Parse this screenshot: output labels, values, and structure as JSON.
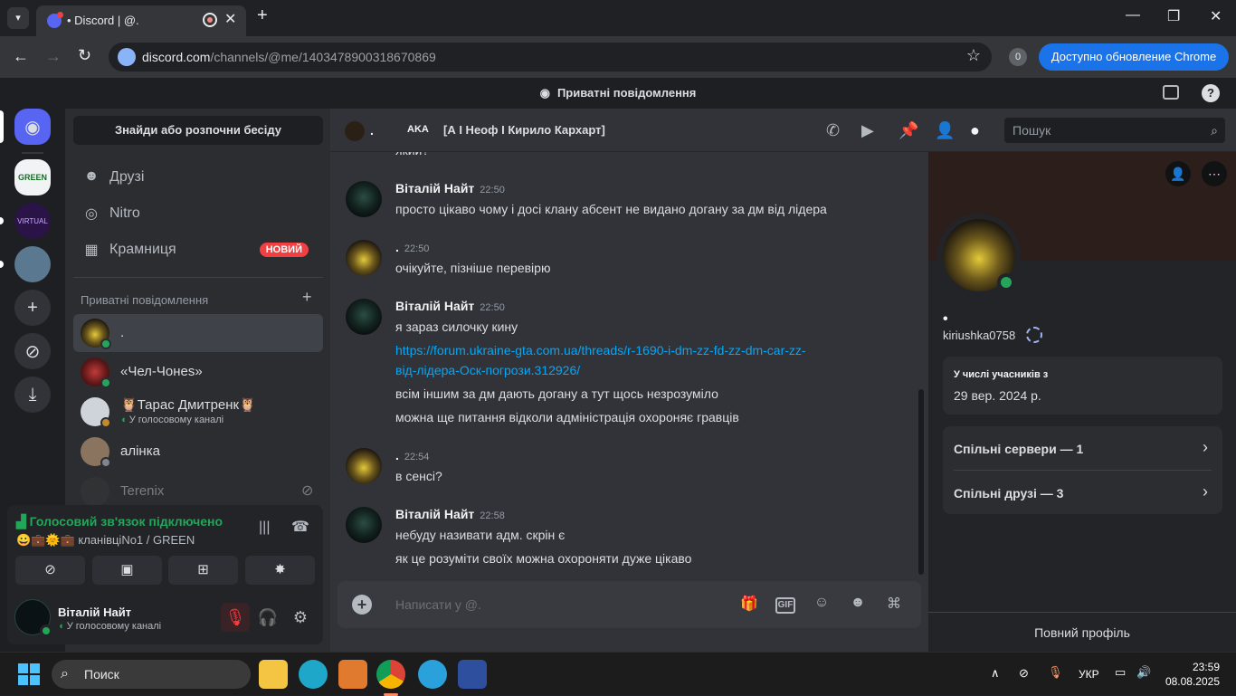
{
  "browser": {
    "tab_title": "• Discord | @.",
    "url_host": "discord.com",
    "url_path": "/channels/@me/1403478900318670869",
    "profile_badge": "0",
    "update_button": "Доступно обновление Chrome"
  },
  "discord_top": {
    "title": "Приватні повідомлення"
  },
  "sidebar": {
    "find_button": "Знайди або розпочни бесіду",
    "nav": [
      {
        "label": "Друзі",
        "icon": "friends-icon"
      },
      {
        "label": "Nitro",
        "icon": "nitro-icon"
      },
      {
        "label": "Крамниця",
        "icon": "shop-icon",
        "badge": "НОВИЙ"
      }
    ],
    "dm_header": "Приватні повідомлення",
    "dms": [
      {
        "name": ".",
        "sub": ""
      },
      {
        "name": "«Чел-Чонеs»",
        "sub": ""
      },
      {
        "name": "Тарас Дмитренк",
        "sub": "У голосовому каналі"
      },
      {
        "name": "алінка",
        "sub": ""
      },
      {
        "name": "Terenix",
        "sub": ""
      }
    ]
  },
  "voice": {
    "status": "Голосовий зв'язок підключено",
    "channel": "кланівціNo1 / GREEN"
  },
  "user": {
    "name": "Віталій Найт",
    "status": "У голосовому каналі"
  },
  "chat": {
    "header_name": ".",
    "aka_label": "AKA",
    "aka_value": "[А І Неоф І Кирило Кархарт]",
    "search_placeholder": "Пошук",
    "composer_placeholder": "Написати у @.",
    "partial_top": "який?",
    "messages": [
      {
        "author": "Віталій Найт",
        "time": "22:50",
        "lines": [
          "просто цікаво чому і досі клану абсент не видано догану за дм від лідера"
        ]
      },
      {
        "author": ".",
        "time": "22:50",
        "lines": [
          "очікуйте, пізніше перевірю"
        ]
      },
      {
        "author": "Віталій Найт",
        "time": "22:50",
        "lines": [
          "я зараз силочку кину",
          "https://forum.ukraine-gta.com.ua/threads/r-1690-i-dm-zz-fd-zz-dm-car-zz-",
          "від-лідера-Оск-погрози.312926/",
          "всім іншим за дм дають догану а тут щось незрозуміло",
          "можна ще питання відколи адміністрація охороняє гравців"
        ]
      },
      {
        "author": ".",
        "time": "22:54",
        "lines": [
          "в сенсі?"
        ]
      },
      {
        "author": "Віталій Найт",
        "time": "22:58",
        "lines": [
          "небуду називати адм. скрін є",
          "як це розуміти своїх можна охороняти дуже цікаво"
        ]
      }
    ]
  },
  "profile": {
    "display": "•",
    "username": "kiriushka0758",
    "member_label": "У числі учасників з",
    "member_date": "29 вер. 2024 р.",
    "mutual_servers": "Спільні сервери — 1",
    "mutual_friends": "Спільні друзі — 3",
    "full_profile": "Повний профіль"
  },
  "taskbar": {
    "search": "Поиск",
    "lang": "УКР",
    "time": "23:59",
    "date": "08.08.2025"
  }
}
